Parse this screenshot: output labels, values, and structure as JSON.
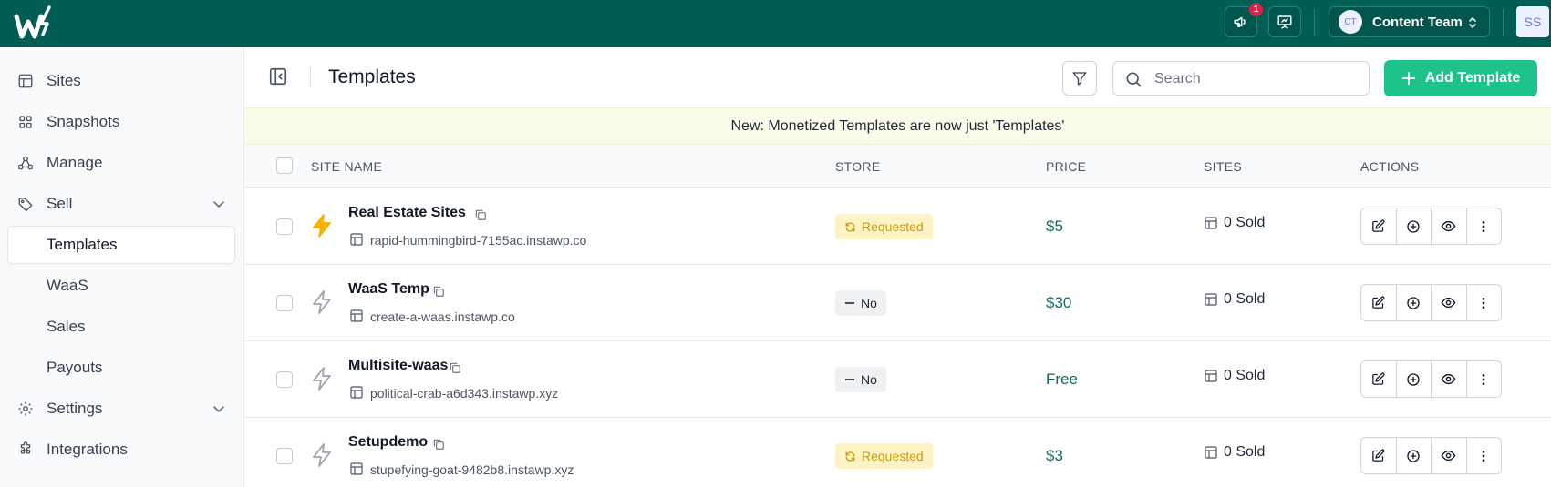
{
  "topbar": {
    "notification_count": "1",
    "team": {
      "initials": "CT",
      "name": "Content Team"
    },
    "user_initials": "SS"
  },
  "sidebar": {
    "items": [
      {
        "label": "Sites",
        "icon": "layout-icon"
      },
      {
        "label": "Snapshots",
        "icon": "grid-icon"
      },
      {
        "label": "Manage",
        "icon": "nodes-icon"
      },
      {
        "label": "Sell",
        "icon": "tag-icon",
        "expanded": true
      },
      {
        "label": "Templates",
        "sub": true,
        "active": true
      },
      {
        "label": "WaaS",
        "sub": true
      },
      {
        "label": "Sales",
        "sub": true
      },
      {
        "label": "Payouts",
        "sub": true
      },
      {
        "label": "Settings",
        "icon": "gear-icon",
        "expandable": true
      },
      {
        "label": "Integrations",
        "icon": "puzzle-icon"
      }
    ]
  },
  "header": {
    "title": "Templates",
    "search_placeholder": "Search",
    "add_label": "Add Template"
  },
  "banner": "New: Monetized Templates are now just 'Templates'",
  "table": {
    "columns": [
      "SITE NAME",
      "STORE",
      "PRICE",
      "SITES",
      "ACTIONS"
    ],
    "rows": [
      {
        "name": "Real Estate Sites",
        "url": "rapid-hummingbird-7155ac.instawp.co",
        "store": "Requested",
        "store_status": "requested",
        "price": "$5",
        "sites": "0 Sold",
        "bolt_color": "#f5b300"
      },
      {
        "name": "WaaS Temp",
        "url": "create-a-waas.instawp.co",
        "store": "No",
        "store_status": "no",
        "price": "$30",
        "sites": "0 Sold",
        "bolt_color": "#9ca3af"
      },
      {
        "name": "Multisite-waas",
        "url": "political-crab-a6d343.instawp.xyz",
        "store": "No",
        "store_status": "no",
        "price": "Free",
        "sites": "0 Sold",
        "bolt_color": "#9ca3af"
      },
      {
        "name": "Setupdemo",
        "url": "stupefying-goat-9482b8.instawp.xyz",
        "store": "Requested",
        "store_status": "requested",
        "price": "$3",
        "sites": "0 Sold",
        "bolt_color": "#9ca3af"
      }
    ]
  },
  "colors": {
    "topbar": "#005e54",
    "accent": "#1ec28b",
    "price": "#0b6b5d",
    "requested_bg": "#fdf3c5",
    "requested_fg": "#d29a06"
  }
}
